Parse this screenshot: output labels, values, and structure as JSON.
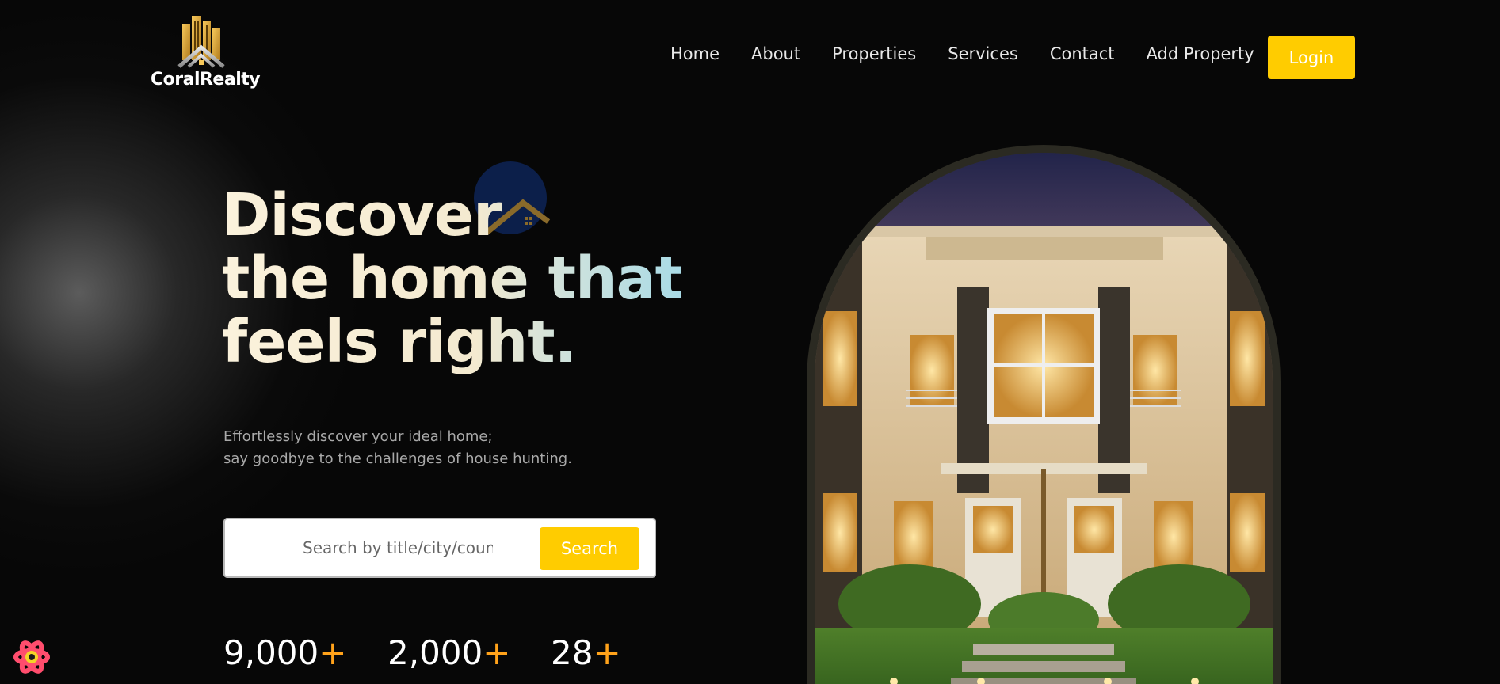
{
  "brand": {
    "name": "CoralRealty",
    "accent_color": "#ffcc00",
    "plus_color": "#ffa21a"
  },
  "nav": {
    "items": [
      "Home",
      "About",
      "Properties",
      "Services",
      "Contact",
      "Add Property"
    ],
    "login_label": "Login"
  },
  "hero": {
    "headline_lines": [
      "Discover",
      "the home that",
      "feels right."
    ],
    "subtext_lines": [
      "Effortlessly discover your ideal home;",
      "say goodbye to the challenges of house hunting."
    ],
    "search": {
      "placeholder": "Search by title/city/country",
      "button_label": "Search"
    },
    "stats": [
      {
        "value": "9,000",
        "suffix": "+"
      },
      {
        "value": "2,000",
        "suffix": "+"
      },
      {
        "value": "28",
        "suffix": "+"
      }
    ]
  },
  "icons": {
    "logo": "building-logo-icon",
    "hero_decoration": "house-roof-icon",
    "floating_badge": "react-devtools-icon"
  }
}
